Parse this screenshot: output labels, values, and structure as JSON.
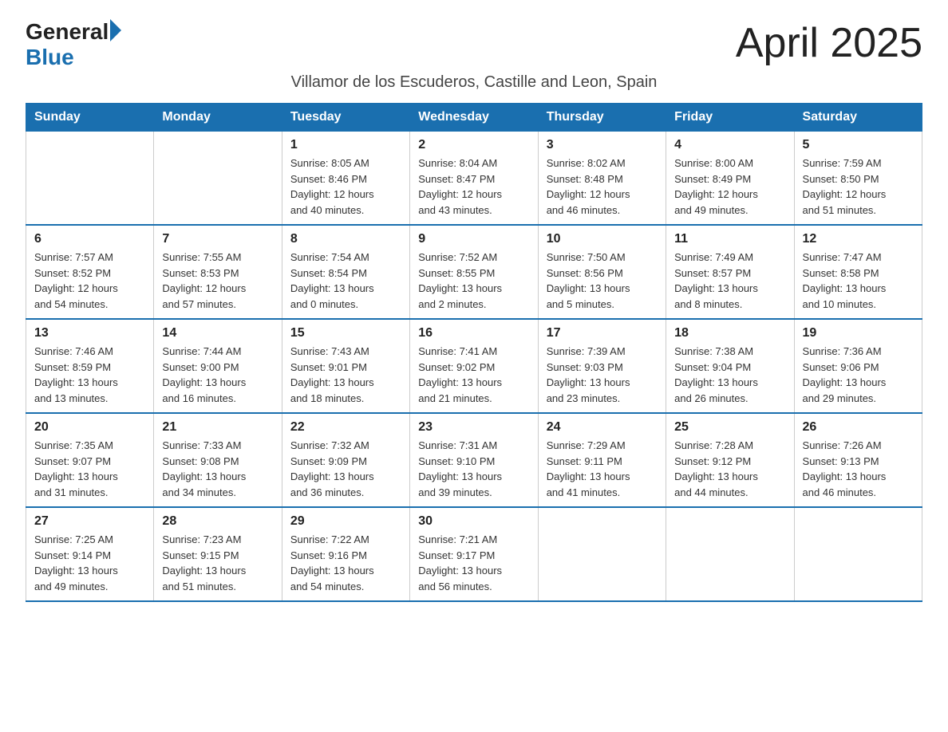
{
  "header": {
    "logo_general": "General",
    "logo_blue": "Blue",
    "month_title": "April 2025",
    "subtitle": "Villamor de los Escuderos, Castille and Leon, Spain"
  },
  "weekdays": [
    "Sunday",
    "Monday",
    "Tuesday",
    "Wednesday",
    "Thursday",
    "Friday",
    "Saturday"
  ],
  "weeks": [
    [
      {
        "day": "",
        "info": ""
      },
      {
        "day": "",
        "info": ""
      },
      {
        "day": "1",
        "info": "Sunrise: 8:05 AM\nSunset: 8:46 PM\nDaylight: 12 hours\nand 40 minutes."
      },
      {
        "day": "2",
        "info": "Sunrise: 8:04 AM\nSunset: 8:47 PM\nDaylight: 12 hours\nand 43 minutes."
      },
      {
        "day": "3",
        "info": "Sunrise: 8:02 AM\nSunset: 8:48 PM\nDaylight: 12 hours\nand 46 minutes."
      },
      {
        "day": "4",
        "info": "Sunrise: 8:00 AM\nSunset: 8:49 PM\nDaylight: 12 hours\nand 49 minutes."
      },
      {
        "day": "5",
        "info": "Sunrise: 7:59 AM\nSunset: 8:50 PM\nDaylight: 12 hours\nand 51 minutes."
      }
    ],
    [
      {
        "day": "6",
        "info": "Sunrise: 7:57 AM\nSunset: 8:52 PM\nDaylight: 12 hours\nand 54 minutes."
      },
      {
        "day": "7",
        "info": "Sunrise: 7:55 AM\nSunset: 8:53 PM\nDaylight: 12 hours\nand 57 minutes."
      },
      {
        "day": "8",
        "info": "Sunrise: 7:54 AM\nSunset: 8:54 PM\nDaylight: 13 hours\nand 0 minutes."
      },
      {
        "day": "9",
        "info": "Sunrise: 7:52 AM\nSunset: 8:55 PM\nDaylight: 13 hours\nand 2 minutes."
      },
      {
        "day": "10",
        "info": "Sunrise: 7:50 AM\nSunset: 8:56 PM\nDaylight: 13 hours\nand 5 minutes."
      },
      {
        "day": "11",
        "info": "Sunrise: 7:49 AM\nSunset: 8:57 PM\nDaylight: 13 hours\nand 8 minutes."
      },
      {
        "day": "12",
        "info": "Sunrise: 7:47 AM\nSunset: 8:58 PM\nDaylight: 13 hours\nand 10 minutes."
      }
    ],
    [
      {
        "day": "13",
        "info": "Sunrise: 7:46 AM\nSunset: 8:59 PM\nDaylight: 13 hours\nand 13 minutes."
      },
      {
        "day": "14",
        "info": "Sunrise: 7:44 AM\nSunset: 9:00 PM\nDaylight: 13 hours\nand 16 minutes."
      },
      {
        "day": "15",
        "info": "Sunrise: 7:43 AM\nSunset: 9:01 PM\nDaylight: 13 hours\nand 18 minutes."
      },
      {
        "day": "16",
        "info": "Sunrise: 7:41 AM\nSunset: 9:02 PM\nDaylight: 13 hours\nand 21 minutes."
      },
      {
        "day": "17",
        "info": "Sunrise: 7:39 AM\nSunset: 9:03 PM\nDaylight: 13 hours\nand 23 minutes."
      },
      {
        "day": "18",
        "info": "Sunrise: 7:38 AM\nSunset: 9:04 PM\nDaylight: 13 hours\nand 26 minutes."
      },
      {
        "day": "19",
        "info": "Sunrise: 7:36 AM\nSunset: 9:06 PM\nDaylight: 13 hours\nand 29 minutes."
      }
    ],
    [
      {
        "day": "20",
        "info": "Sunrise: 7:35 AM\nSunset: 9:07 PM\nDaylight: 13 hours\nand 31 minutes."
      },
      {
        "day": "21",
        "info": "Sunrise: 7:33 AM\nSunset: 9:08 PM\nDaylight: 13 hours\nand 34 minutes."
      },
      {
        "day": "22",
        "info": "Sunrise: 7:32 AM\nSunset: 9:09 PM\nDaylight: 13 hours\nand 36 minutes."
      },
      {
        "day": "23",
        "info": "Sunrise: 7:31 AM\nSunset: 9:10 PM\nDaylight: 13 hours\nand 39 minutes."
      },
      {
        "day": "24",
        "info": "Sunrise: 7:29 AM\nSunset: 9:11 PM\nDaylight: 13 hours\nand 41 minutes."
      },
      {
        "day": "25",
        "info": "Sunrise: 7:28 AM\nSunset: 9:12 PM\nDaylight: 13 hours\nand 44 minutes."
      },
      {
        "day": "26",
        "info": "Sunrise: 7:26 AM\nSunset: 9:13 PM\nDaylight: 13 hours\nand 46 minutes."
      }
    ],
    [
      {
        "day": "27",
        "info": "Sunrise: 7:25 AM\nSunset: 9:14 PM\nDaylight: 13 hours\nand 49 minutes."
      },
      {
        "day": "28",
        "info": "Sunrise: 7:23 AM\nSunset: 9:15 PM\nDaylight: 13 hours\nand 51 minutes."
      },
      {
        "day": "29",
        "info": "Sunrise: 7:22 AM\nSunset: 9:16 PM\nDaylight: 13 hours\nand 54 minutes."
      },
      {
        "day": "30",
        "info": "Sunrise: 7:21 AM\nSunset: 9:17 PM\nDaylight: 13 hours\nand 56 minutes."
      },
      {
        "day": "",
        "info": ""
      },
      {
        "day": "",
        "info": ""
      },
      {
        "day": "",
        "info": ""
      }
    ]
  ]
}
